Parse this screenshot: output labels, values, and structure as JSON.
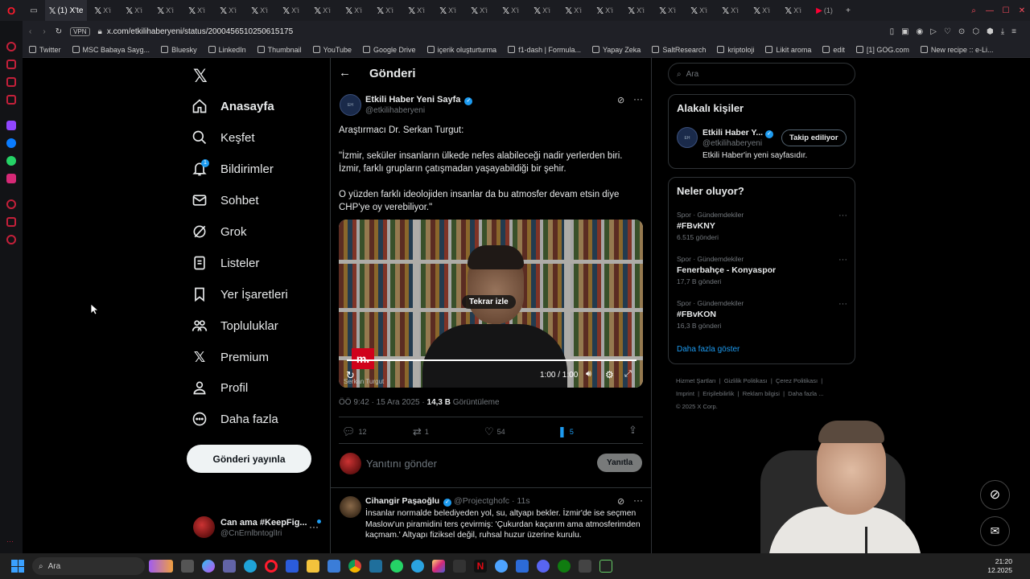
{
  "browser": {
    "active_tab": {
      "label": "(1) X'te",
      "sub": ""
    },
    "other_tab_label": "X'i",
    "last_tab_label": "(1)",
    "vpn_label": "VPN",
    "url": "x.com/etkilihaberyeni/status/2000456510250615175",
    "bookmarks": [
      "Twitter",
      "MSC Babaya Sayg...",
      "Bluesky",
      "LinkedIn",
      "Thumbnail",
      "YouTube",
      "Google Drive",
      "içerik oluşturturma",
      "f1-dash | Formula...",
      "Yapay Zeka",
      "SaltResearch",
      "kriptoloji",
      "Likit aroma",
      "edit",
      "[1] GOG.com",
      "New recipe :: e-Li..."
    ]
  },
  "nav": {
    "items": [
      "Anasayfa",
      "Keşfet",
      "Bildirimler",
      "Sohbet",
      "Grok",
      "Listeler",
      "Yer İşaretleri",
      "Topluluklar",
      "Premium",
      "Profil",
      "Daha fazla"
    ],
    "notification_badge": "1",
    "post_button": "Gönderi yayınla",
    "account": {
      "name": "Can ama #KeepFig...",
      "handle": "@CnErnlbntoglIri"
    }
  },
  "post": {
    "header_title": "Gönderi",
    "author_name": "Etkili Haber Yeni Sayfa",
    "author_handle": "@etkilihaberyeni",
    "text_line1": "Araştırmacı Dr. Serkan Turgut:",
    "text_para2": "\"İzmir, seküler insanların ülkede nefes alabileceği nadir yerlerden biri. İzmir, farklı grupların çatışmadan yaşayabildiği bir şehir.",
    "text_para3": "O yüzden farklı ideolojiden insanlar da bu atmosfer devam etsin diye CHP'ye oy verebiliyor.\"",
    "video": {
      "replay_label": "Tekrar izle",
      "time": "1:00 / 1:00",
      "caption": "Serkan Turgut",
      "logo": "m."
    },
    "meta_time": "ÖÖ 9:42 · 15 Ara 2025 · ",
    "views": "14,3 B",
    "views_label": "Görüntüleme",
    "stats": {
      "replies": "12",
      "reposts": "1",
      "likes": "54",
      "bookmarks": "5"
    },
    "reply_placeholder": "Yanıtını gönder",
    "reply_button": "Yanıtla"
  },
  "reply": {
    "name": "Cihangir Paşaoğlu",
    "handle": "@Projectghofc · 11s",
    "text": "İnsanlar normalde belediyeden yol, su, altyapı bekler. İzmir'de ise seçmen Maslow'un piramidini ters çevirmiş: 'Çukurdan kaçarım ama atmosferimden kaçmam.' Altyapı fiziksel değil, ruhsal huzur üzerine kurulu."
  },
  "right": {
    "search_placeholder": "Ara",
    "related_title": "Alakalı kişiler",
    "related_name": "Etkili Haber Y...",
    "related_handle": "@etkilihaberyeni",
    "related_bio": "Etkili Haber'in yeni sayfasıdır.",
    "follow_button": "Takip ediliyor",
    "trends_title": "Neler oluyor?",
    "trends": [
      {
        "category": "Spor · Gündemdekiler",
        "name": "#FBvKNY",
        "count": "6.515 gönderi"
      },
      {
        "category": "Spor · Gündemdekiler",
        "name": "Fenerbahçe - Konyaspor",
        "count": "17,7 B gönderi"
      },
      {
        "category": "Spor · Gündemdekiler",
        "name": "#FBvKON",
        "count": "16,3 B gönderi"
      }
    ],
    "show_more": "Daha fazla göster",
    "footer": [
      "Hizmet Şartları",
      "Gizlilik Politikası",
      "Çerez Politikası",
      "Imprint",
      "Erişilebilirlik",
      "Reklam bilgisi",
      "Daha fazla ..."
    ],
    "copyright": "© 2025 X Corp."
  },
  "taskbar": {
    "search_placeholder": "Ara",
    "clock_time": "21:20",
    "clock_date": "12.2025"
  },
  "colors": {
    "accent": "#1d9bf0",
    "background": "#000000",
    "border": "#2f3336",
    "muted": "#71767b"
  }
}
